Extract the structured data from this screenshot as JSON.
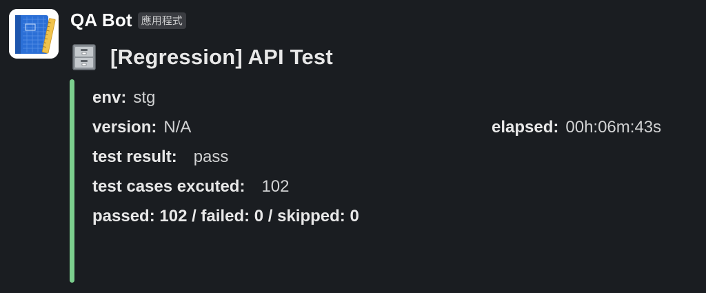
{
  "message": {
    "bot_name": "QA Bot",
    "app_badge": "應用程式",
    "title": "[Regression] API Test",
    "title_icon": "file-cabinet-icon",
    "accent_color": "#7ccf8e",
    "fields": {
      "env_label": "env:",
      "env_value": "stg",
      "version_label": "version:",
      "version_value": "N/A",
      "elapsed_label": "elapsed:",
      "elapsed_value": "00h:06m:43s",
      "result_label": "test result:",
      "result_value": "pass",
      "cases_label": "test cases excuted:",
      "cases_value": "102",
      "summary": "passed: 102 / failed: 0 / skipped: 0"
    }
  }
}
